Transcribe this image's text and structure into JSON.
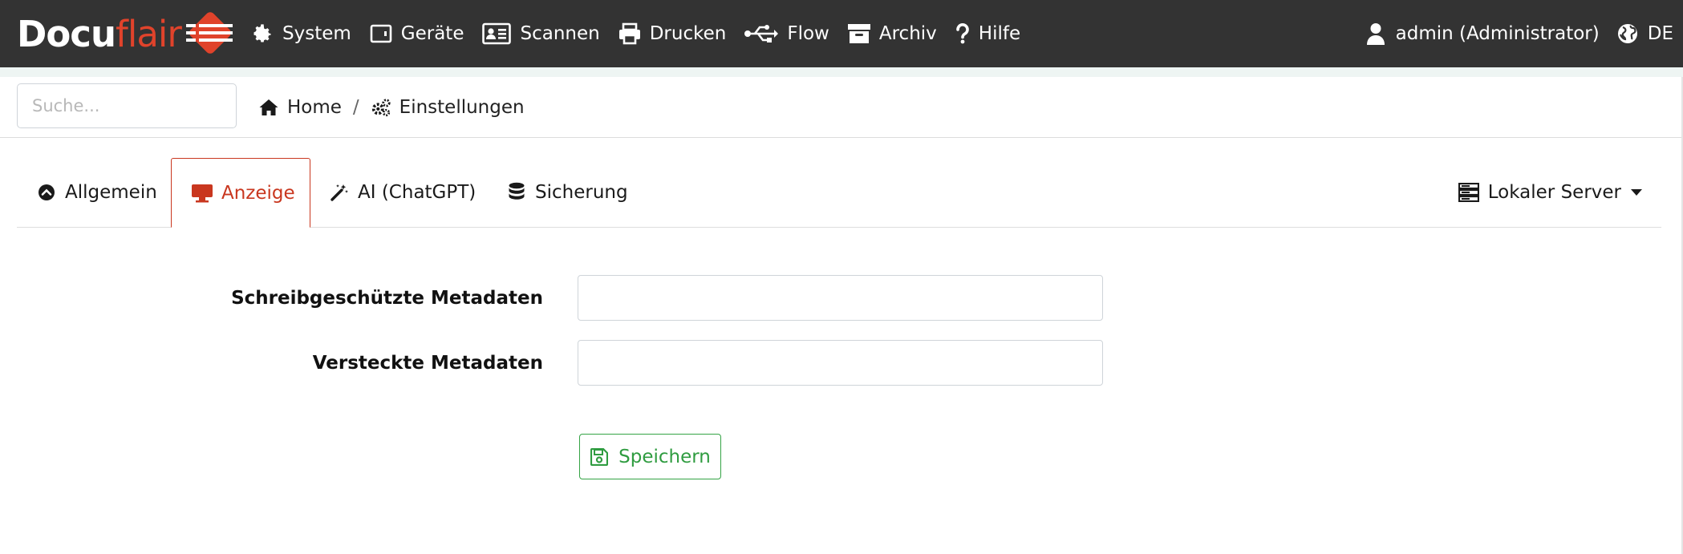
{
  "brand": {
    "name_part1": "Docu",
    "name_part2": "flair",
    "accent_color": "#e0432b"
  },
  "nav": {
    "items": [
      {
        "label": "System",
        "icon": "gear-icon"
      },
      {
        "label": "Geräte",
        "icon": "tablet-icon"
      },
      {
        "label": "Scannen",
        "icon": "id-card-icon"
      },
      {
        "label": "Drucken",
        "icon": "printer-icon"
      },
      {
        "label": "Flow",
        "icon": "usb-icon"
      },
      {
        "label": "Archiv",
        "icon": "archive-box-icon"
      },
      {
        "label": "Hilfe",
        "icon": "question-icon"
      }
    ],
    "user_label": "admin (Administrator)",
    "language": "DE"
  },
  "search": {
    "placeholder": "Suche..."
  },
  "breadcrumb": {
    "home": "Home",
    "current": "Einstellungen"
  },
  "tabs": {
    "items": [
      {
        "label": "Allgemein",
        "icon": "circle-chevron-up-icon",
        "active": false
      },
      {
        "label": "Anzeige",
        "icon": "desktop-icon",
        "active": true
      },
      {
        "label": "AI (ChatGPT)",
        "icon": "magic-wand-icon",
        "active": false
      },
      {
        "label": "Sicherung",
        "icon": "database-icon",
        "active": false
      }
    ],
    "server_dropdown_label": "Lokaler Server",
    "active_color": "#c9371f"
  },
  "form": {
    "readonly_metadata_label": "Schreibgeschützte Metadaten",
    "readonly_metadata_value": "",
    "hidden_metadata_label": "Versteckte Metadaten",
    "hidden_metadata_value": "",
    "save_label": "Speichern",
    "save_color": "#34a345"
  }
}
